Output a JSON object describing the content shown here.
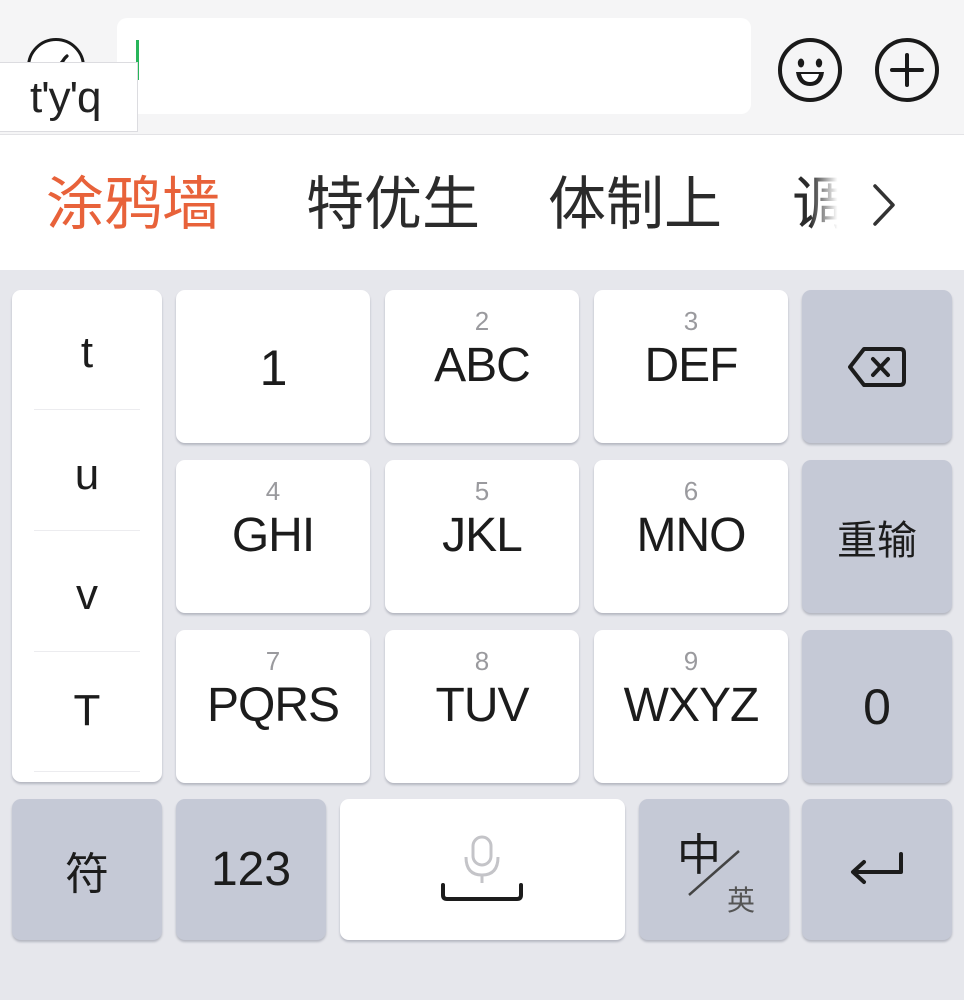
{
  "input_bar": {
    "pinyin_composition": "t'y'q",
    "voice_icon": "voice-icon",
    "emoji_icon": "emoji-smile-icon",
    "plus_icon": "plus-circle-icon",
    "caret_color": "#27b55a"
  },
  "candidates": {
    "items": [
      "涂鸦墙",
      "特优生",
      "体制上",
      "调"
    ],
    "highlight_color": "#e8623a",
    "more_icon": "chevron-right-icon"
  },
  "letter_column": {
    "items": [
      "t",
      "u",
      "v",
      "T"
    ]
  },
  "keys": {
    "k1": {
      "main": "1"
    },
    "k2": {
      "num": "2",
      "main": "ABC"
    },
    "k3": {
      "num": "3",
      "main": "DEF"
    },
    "k4": {
      "num": "4",
      "main": "GHI"
    },
    "k5": {
      "num": "5",
      "main": "JKL"
    },
    "k6": {
      "num": "6",
      "main": "MNO"
    },
    "k7": {
      "num": "7",
      "main": "PQRS"
    },
    "k8": {
      "num": "8",
      "main": "TUV"
    },
    "k9": {
      "num": "9",
      "main": "WXYZ"
    },
    "backspace_icon": "backspace-icon",
    "reinput": "重输",
    "zero": "0",
    "symbol": "符",
    "numeric": "123",
    "space_icon": "space-microphone-icon",
    "lang_zh": "中",
    "lang_en": "英",
    "enter_icon": "enter-return-icon"
  },
  "colors": {
    "key_white": "#ffffff",
    "key_gray": "#c5c9d6",
    "keyboard_bg": "#e6e7ec"
  }
}
